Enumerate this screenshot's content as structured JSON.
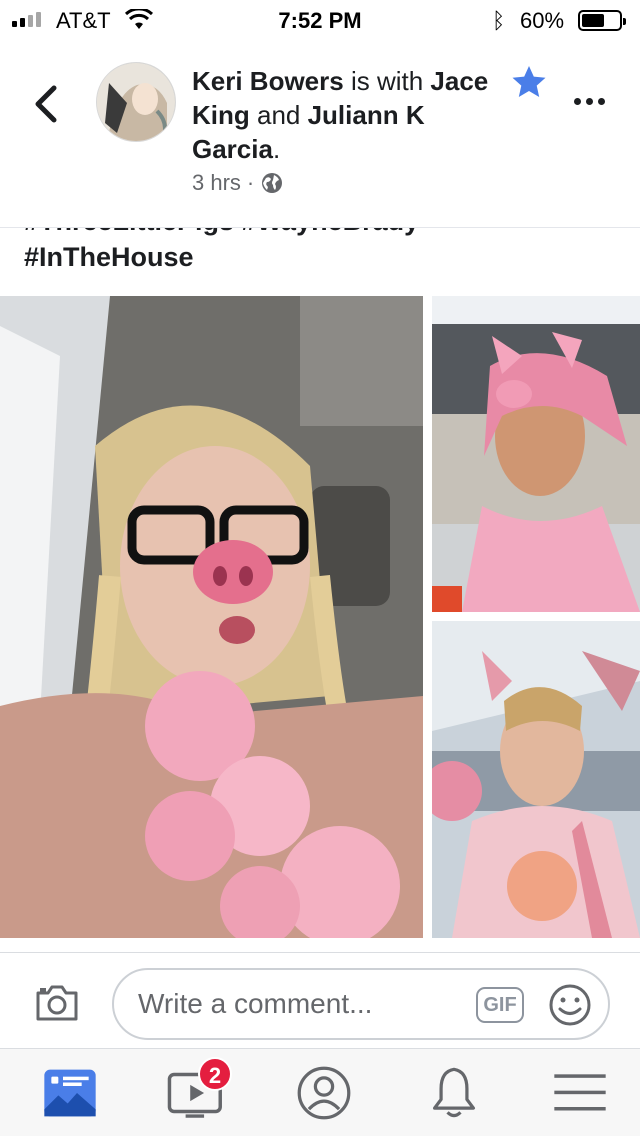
{
  "status_bar": {
    "carrier": "AT&T",
    "time": "7:52 PM",
    "battery_percent": "60%",
    "battery_level": 0.6
  },
  "header": {
    "author": "Keri Bowers",
    "connector": " is with ",
    "tagged_1": "Jace King",
    "and": " and ",
    "tagged_2": "Juliann K Garcia",
    "period": ".",
    "time_ago": "3 hrs",
    "separator": "·",
    "privacy_icon": "globe-icon",
    "favorite_icon": "star-icon",
    "more_icon": "more-dots-icon",
    "back_icon": "chevron-left-icon"
  },
  "post": {
    "cut_text": "#ThreeLittlePigs #WayneBrady",
    "hashtag_last": "#InTheHouse"
  },
  "comment_bar": {
    "placeholder": "Write a comment...",
    "gif_label": "GIF",
    "camera_icon": "camera-icon",
    "emoji_icon": "smiley-icon"
  },
  "tab_bar": {
    "tabs": [
      {
        "name": "News Feed",
        "icon": "news-feed-icon",
        "active": true
      },
      {
        "name": "Watch",
        "icon": "video-icon",
        "badge": "2"
      },
      {
        "name": "Profile",
        "icon": "profile-icon"
      },
      {
        "name": "Notifications",
        "icon": "bell-icon"
      },
      {
        "name": "Menu",
        "icon": "hamburger-icon"
      }
    ]
  },
  "colors": {
    "accent": "#4a7ee8",
    "badge": "#e41e3f",
    "text": "#1c1e21",
    "secondary": "#65676b"
  }
}
